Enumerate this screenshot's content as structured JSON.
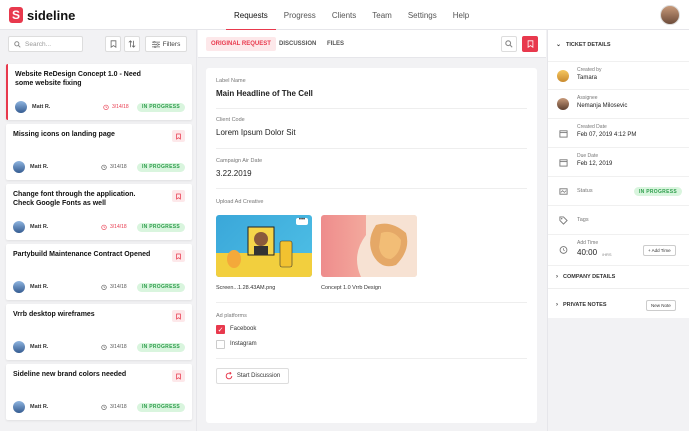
{
  "app": {
    "name": "sideline"
  },
  "nav": {
    "items": [
      "Requests",
      "Progress",
      "Clients",
      "Team",
      "Settings",
      "Help"
    ],
    "active": "Requests"
  },
  "left": {
    "search_placeholder": "Search...",
    "filters_label": "Filters",
    "tickets": [
      {
        "title": "Website ReDesign Concept 1.0 - Need some website fixing",
        "user": "Matt R.",
        "date": "3/14/18",
        "status": "IN PROGRESS",
        "date_alert": true,
        "selected": true
      },
      {
        "title": "Missing icons on landing page",
        "user": "Matt R.",
        "date": "3/14/18",
        "status": "IN PROGRESS",
        "date_alert": false,
        "selected": false
      },
      {
        "title": "Change font through the application. Check Google Fonts as well",
        "user": "Matt R.",
        "date": "3/14/18",
        "status": "IN PROGRESS",
        "date_alert": true,
        "selected": false
      },
      {
        "title": "Partybuild Maintenance Contract Opened",
        "user": "Matt R.",
        "date": "3/14/18",
        "status": "IN PROGRESS",
        "date_alert": false,
        "selected": false
      },
      {
        "title": "Vrrb desktop wireframes",
        "user": "Matt R.",
        "date": "3/14/18",
        "status": "IN PROGRESS",
        "date_alert": false,
        "selected": false
      },
      {
        "title": "Sideline new brand colors needed",
        "user": "Matt R.",
        "date": "3/14/18",
        "status": "IN PROGRESS",
        "date_alert": false,
        "selected": false
      }
    ]
  },
  "center": {
    "tabs": [
      "ORIGINAL REQUEST",
      "DISCUSSION",
      "FILES"
    ],
    "fields": {
      "label_name_label": "Label Name",
      "label_name_value": "Main Headline of The Cell",
      "client_code_label": "Client Code",
      "client_code_value": "Lorem Ipsum Dolor Sit",
      "air_date_label": "Campaign Air Date",
      "air_date_value": "3.22.2019",
      "upload_label": "Upload Ad Creative",
      "file1": "Screen...1.28.43AM.png",
      "file2": "Concept 1.0 Vrrb Design",
      "platforms_label": "Ad platforms",
      "platform1": "Facebook",
      "platform2": "Instagram",
      "start_btn": "Start Discussion"
    }
  },
  "right": {
    "ticket_details": "TICKET DETAILS",
    "created_by_label": "Created by",
    "created_by": "Tamara",
    "assignee_label": "Assignee",
    "assignee": "Nemanja Milosevic",
    "created_date_label": "Created Date",
    "created_date": "Feb 07, 2019 4:12 PM",
    "due_date_label": "Due Date",
    "due_date": "Feb 12, 2019",
    "status_label": "Status",
    "status": "IN PROGRESS",
    "tags_label": "Tags",
    "add_time_label": "Add Time",
    "add_time_value": "40:00",
    "add_time_unit": "/HRS",
    "add_time_btn": "+ Add Time",
    "company_details": "COMPANY DETAILS",
    "private_notes": "PRIVATE NOTES",
    "new_note_btn": "New Note"
  },
  "colors": {
    "accent": "#e8394d",
    "success_bg": "#d9f5de",
    "success_text": "#2e9e4c"
  }
}
